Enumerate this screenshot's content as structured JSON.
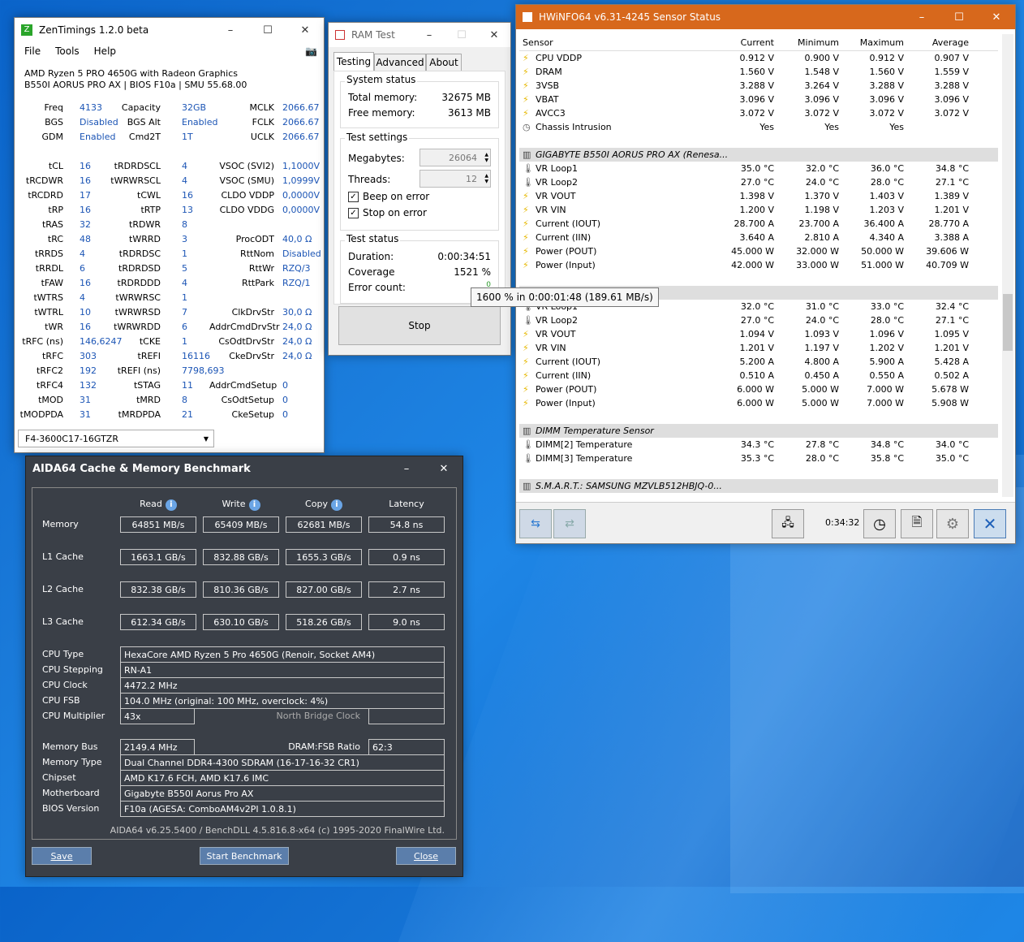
{
  "zen": {
    "title": "ZenTimings 1.2.0 beta",
    "menu": [
      "File",
      "Tools",
      "Help"
    ],
    "cpu": "AMD Ryzen 5 PRO 4650G with Radeon Graphics",
    "board": "B550I AORUS PRO AX | BIOS F10a | SMU 55.68.00",
    "top_rows": [
      [
        "Freq",
        "4133",
        "Capacity",
        "32GB",
        "MCLK",
        "2066.67"
      ],
      [
        "BGS",
        "Disabled",
        "BGS Alt",
        "Enabled",
        "FCLK",
        "2066.67"
      ],
      [
        "GDM",
        "Enabled",
        "Cmd2T",
        "1T",
        "UCLK",
        "2066.67"
      ]
    ],
    "rows": [
      [
        "tCL",
        "16",
        "tRDRDSCL",
        "4",
        "VSOC (SVI2)",
        "1,1000V"
      ],
      [
        "tRCDWR",
        "16",
        "tWRWRSCL",
        "4",
        "VSOC (SMU)",
        "1,0999V"
      ],
      [
        "tRCDRD",
        "17",
        "tCWL",
        "16",
        "CLDO VDDP",
        "0,0000V"
      ],
      [
        "tRP",
        "16",
        "tRTP",
        "13",
        "CLDO VDDG",
        "0,0000V"
      ],
      [
        "tRAS",
        "32",
        "tRDWR",
        "8",
        "",
        ""
      ],
      [
        "tRC",
        "48",
        "tWRRD",
        "3",
        "ProcODT",
        "40,0 Ω"
      ],
      [
        "tRRDS",
        "4",
        "tRDRDSC",
        "1",
        "RttNom",
        "Disabled"
      ],
      [
        "tRRDL",
        "6",
        "tRDRDSD",
        "5",
        "RttWr",
        "RZQ/3"
      ],
      [
        "tFAW",
        "16",
        "tRDRDDD",
        "4",
        "RttPark",
        "RZQ/1"
      ],
      [
        "tWTRS",
        "4",
        "tWRWRSC",
        "1",
        "",
        ""
      ],
      [
        "tWTRL",
        "10",
        "tWRWRSD",
        "7",
        "ClkDrvStr",
        "30,0 Ω"
      ],
      [
        "tWR",
        "16",
        "tWRWRDD",
        "6",
        "AddrCmdDrvStr",
        "24,0 Ω"
      ],
      [
        "tRFC (ns)",
        "146,6247",
        "tCKE",
        "1",
        "CsOdtDrvStr",
        "24,0 Ω"
      ],
      [
        "tRFC",
        "303",
        "tREFI",
        "16116",
        "CkeDrvStr",
        "24,0 Ω"
      ],
      [
        "tRFC2",
        "192",
        "tREFI (ns)",
        "7798,693",
        "",
        ""
      ],
      [
        "tRFC4",
        "132",
        "tSTAG",
        "11",
        "AddrCmdSetup",
        "0"
      ],
      [
        "tMOD",
        "31",
        "tMRD",
        "8",
        "CsOdtSetup",
        "0"
      ],
      [
        "tMODPDA",
        "31",
        "tMRDPDA",
        "21",
        "CkeSetup",
        "0"
      ]
    ],
    "module": "F4-3600C17-16GTZR"
  },
  "ram": {
    "title": "RAM Test",
    "tabs": [
      "Testing",
      "Advanced",
      "About"
    ],
    "system_status": "System status",
    "total_label": "Total memory:",
    "total_value": "32675 MB",
    "free_label": "Free memory:",
    "free_value": "3613 MB",
    "test_settings": "Test settings",
    "mb_label": "Megabytes:",
    "mb_value": "26064",
    "threads_label": "Threads:",
    "threads_value": "12",
    "beep": "Beep on error",
    "stop_on_error": "Stop on error",
    "test_status": "Test status",
    "duration_label": "Duration:",
    "duration_value": "0:00:34:51",
    "coverage_label": "Coverage",
    "coverage_value": "1521 %",
    "error_label": "Error count:",
    "error_value": "0",
    "tooltip": "1600 % in 0:00:01:48 (189.61 MB/s)",
    "stop": "Stop"
  },
  "hw": {
    "title": "HWiNFO64 v6.31-4245 Sensor Status",
    "headers": [
      "Sensor",
      "Current",
      "Minimum",
      "Maximum",
      "Average"
    ],
    "rows": [
      {
        "icon": "bolt",
        "name": "CPU VDDP",
        "v": [
          "0.912 V",
          "0.900 V",
          "0.912 V",
          "0.907 V"
        ]
      },
      {
        "icon": "bolt",
        "name": "DRAM",
        "v": [
          "1.560 V",
          "1.548 V",
          "1.560 V",
          "1.559 V"
        ]
      },
      {
        "icon": "bolt",
        "name": "3VSB",
        "v": [
          "3.288 V",
          "3.264 V",
          "3.288 V",
          "3.288 V"
        ]
      },
      {
        "icon": "bolt",
        "name": "VBAT",
        "v": [
          "3.096 V",
          "3.096 V",
          "3.096 V",
          "3.096 V"
        ]
      },
      {
        "icon": "bolt",
        "name": "AVCC3",
        "v": [
          "3.072 V",
          "3.072 V",
          "3.072 V",
          "3.072 V"
        ]
      },
      {
        "icon": "clock",
        "name": "Chassis Intrusion",
        "v": [
          "Yes",
          "Yes",
          "Yes",
          ""
        ]
      },
      {
        "icon": "blank",
        "name": "",
        "v": [
          "",
          "",
          "",
          ""
        ]
      },
      {
        "icon": "chip",
        "name": "GIGABYTE B550I AORUS PRO AX (Renesa...",
        "v": [
          "",
          "",
          "",
          ""
        ],
        "section": true
      },
      {
        "icon": "therm",
        "name": "VR Loop1",
        "v": [
          "35.0 °C",
          "32.0 °C",
          "36.0 °C",
          "34.8 °C"
        ]
      },
      {
        "icon": "therm",
        "name": "VR Loop2",
        "v": [
          "27.0 °C",
          "24.0 °C",
          "28.0 °C",
          "27.1 °C"
        ]
      },
      {
        "icon": "bolt",
        "name": "VR VOUT",
        "v": [
          "1.398 V",
          "1.370 V",
          "1.403 V",
          "1.389 V"
        ]
      },
      {
        "icon": "bolt",
        "name": "VR VIN",
        "v": [
          "1.200 V",
          "1.198 V",
          "1.203 V",
          "1.201 V"
        ]
      },
      {
        "icon": "bolt",
        "name": "Current (IOUT)",
        "v": [
          "28.700 A",
          "23.700 A",
          "36.400 A",
          "28.770 A"
        ]
      },
      {
        "icon": "bolt",
        "name": "Current (IIN)",
        "v": [
          "3.640 A",
          "2.810 A",
          "4.340 A",
          "3.388 A"
        ]
      },
      {
        "icon": "bolt",
        "name": "Power (POUT)",
        "v": [
          "45.000 W",
          "32.000 W",
          "50.000 W",
          "39.606 W"
        ]
      },
      {
        "icon": "bolt",
        "name": "Power (Input)",
        "v": [
          "42.000 W",
          "33.000 W",
          "51.000 W",
          "40.709 W"
        ]
      },
      {
        "icon": "blank",
        "name": "",
        "v": [
          "",
          "",
          "",
          ""
        ]
      },
      {
        "icon": "chip",
        "name": "PRO AX (Renesa...",
        "v": [
          "",
          "",
          "",
          ""
        ],
        "section": true
      },
      {
        "icon": "therm",
        "name": "VR Loop1",
        "v": [
          "32.0 °C",
          "31.0 °C",
          "33.0 °C",
          "32.4 °C"
        ]
      },
      {
        "icon": "therm",
        "name": "VR Loop2",
        "v": [
          "27.0 °C",
          "24.0 °C",
          "28.0 °C",
          "27.1 °C"
        ]
      },
      {
        "icon": "bolt",
        "name": "VR VOUT",
        "v": [
          "1.094 V",
          "1.093 V",
          "1.096 V",
          "1.095 V"
        ]
      },
      {
        "icon": "bolt",
        "name": "VR VIN",
        "v": [
          "1.201 V",
          "1.197 V",
          "1.202 V",
          "1.201 V"
        ]
      },
      {
        "icon": "bolt",
        "name": "Current (IOUT)",
        "v": [
          "5.200 A",
          "4.800 A",
          "5.900 A",
          "5.428 A"
        ]
      },
      {
        "icon": "bolt",
        "name": "Current (IIN)",
        "v": [
          "0.510 A",
          "0.450 A",
          "0.550 A",
          "0.502 A"
        ]
      },
      {
        "icon": "bolt",
        "name": "Power (POUT)",
        "v": [
          "6.000 W",
          "5.000 W",
          "7.000 W",
          "5.678 W"
        ]
      },
      {
        "icon": "bolt",
        "name": "Power (Input)",
        "v": [
          "6.000 W",
          "5.000 W",
          "7.000 W",
          "5.908 W"
        ]
      },
      {
        "icon": "blank",
        "name": "",
        "v": [
          "",
          "",
          "",
          ""
        ]
      },
      {
        "icon": "chip",
        "name": "DIMM Temperature Sensor",
        "v": [
          "",
          "",
          "",
          ""
        ],
        "section": true
      },
      {
        "icon": "therm",
        "name": "DIMM[2] Temperature",
        "v": [
          "34.3 °C",
          "27.8 °C",
          "34.8 °C",
          "34.0 °C"
        ]
      },
      {
        "icon": "therm",
        "name": "DIMM[3] Temperature",
        "v": [
          "35.3 °C",
          "28.0 °C",
          "35.8 °C",
          "35.0 °C"
        ]
      },
      {
        "icon": "blank",
        "name": "",
        "v": [
          "",
          "",
          "",
          ""
        ]
      },
      {
        "icon": "chip",
        "name": "S.M.A.R.T.: SAMSUNG MZVLB512HBJQ-0...",
        "v": [
          "",
          "",
          "",
          ""
        ],
        "section": true
      }
    ],
    "elapsed": "0:34:32"
  },
  "aida": {
    "title": "AIDA64 Cache & Memory Benchmark",
    "cols": [
      "Read",
      "Write",
      "Copy",
      "Latency"
    ],
    "bench": [
      {
        "label": "Memory",
        "v": [
          "64851 MB/s",
          "65409 MB/s",
          "62681 MB/s",
          "54.8 ns"
        ]
      },
      {
        "label": "L1 Cache",
        "v": [
          "1663.1 GB/s",
          "832.88 GB/s",
          "1655.3 GB/s",
          "0.9 ns"
        ]
      },
      {
        "label": "L2 Cache",
        "v": [
          "832.38 GB/s",
          "810.36 GB/s",
          "827.00 GB/s",
          "2.7 ns"
        ]
      },
      {
        "label": "L3 Cache",
        "v": [
          "612.34 GB/s",
          "630.10 GB/s",
          "518.26 GB/s",
          "9.0 ns"
        ]
      }
    ],
    "cpu_type_label": "CPU Type",
    "cpu_type": "HexaCore AMD Ryzen 5 Pro 4650G  (Renoir, Socket AM4)",
    "cpu_stepping_label": "CPU Stepping",
    "cpu_stepping": "RN-A1",
    "cpu_clock_label": "CPU Clock",
    "cpu_clock": "4472.2 MHz",
    "cpu_fsb_label": "CPU FSB",
    "cpu_fsb": "104.0 MHz  (original: 100 MHz, overclock: 4%)",
    "cpu_mult_label": "CPU Multiplier",
    "cpu_mult": "43x",
    "nb_clock_label": "North Bridge Clock",
    "nb_clock": "",
    "mem_bus_label": "Memory Bus",
    "mem_bus": "2149.4 MHz",
    "dram_ratio_label": "DRAM:FSB Ratio",
    "dram_ratio": "62:3",
    "mem_type_label": "Memory Type",
    "mem_type": "Dual Channel DDR4-4300 SDRAM  (16-17-16-32 CR1)",
    "chipset_label": "Chipset",
    "chipset": "AMD K17.6 FCH, AMD K17.6 IMC",
    "mobo_label": "Motherboard",
    "mobo": "Gigabyte B550I Aorus Pro AX",
    "bios_label": "BIOS Version",
    "bios": "F10a  (AGESA: ComboAM4v2PI 1.0.8.1)",
    "footer": "AIDA64 v6.25.5400 / BenchDLL 4.5.816.8-x64  (c) 1995-2020 FinalWire Ltd.",
    "save": "Save",
    "start": "Start Benchmark",
    "close": "Close"
  }
}
